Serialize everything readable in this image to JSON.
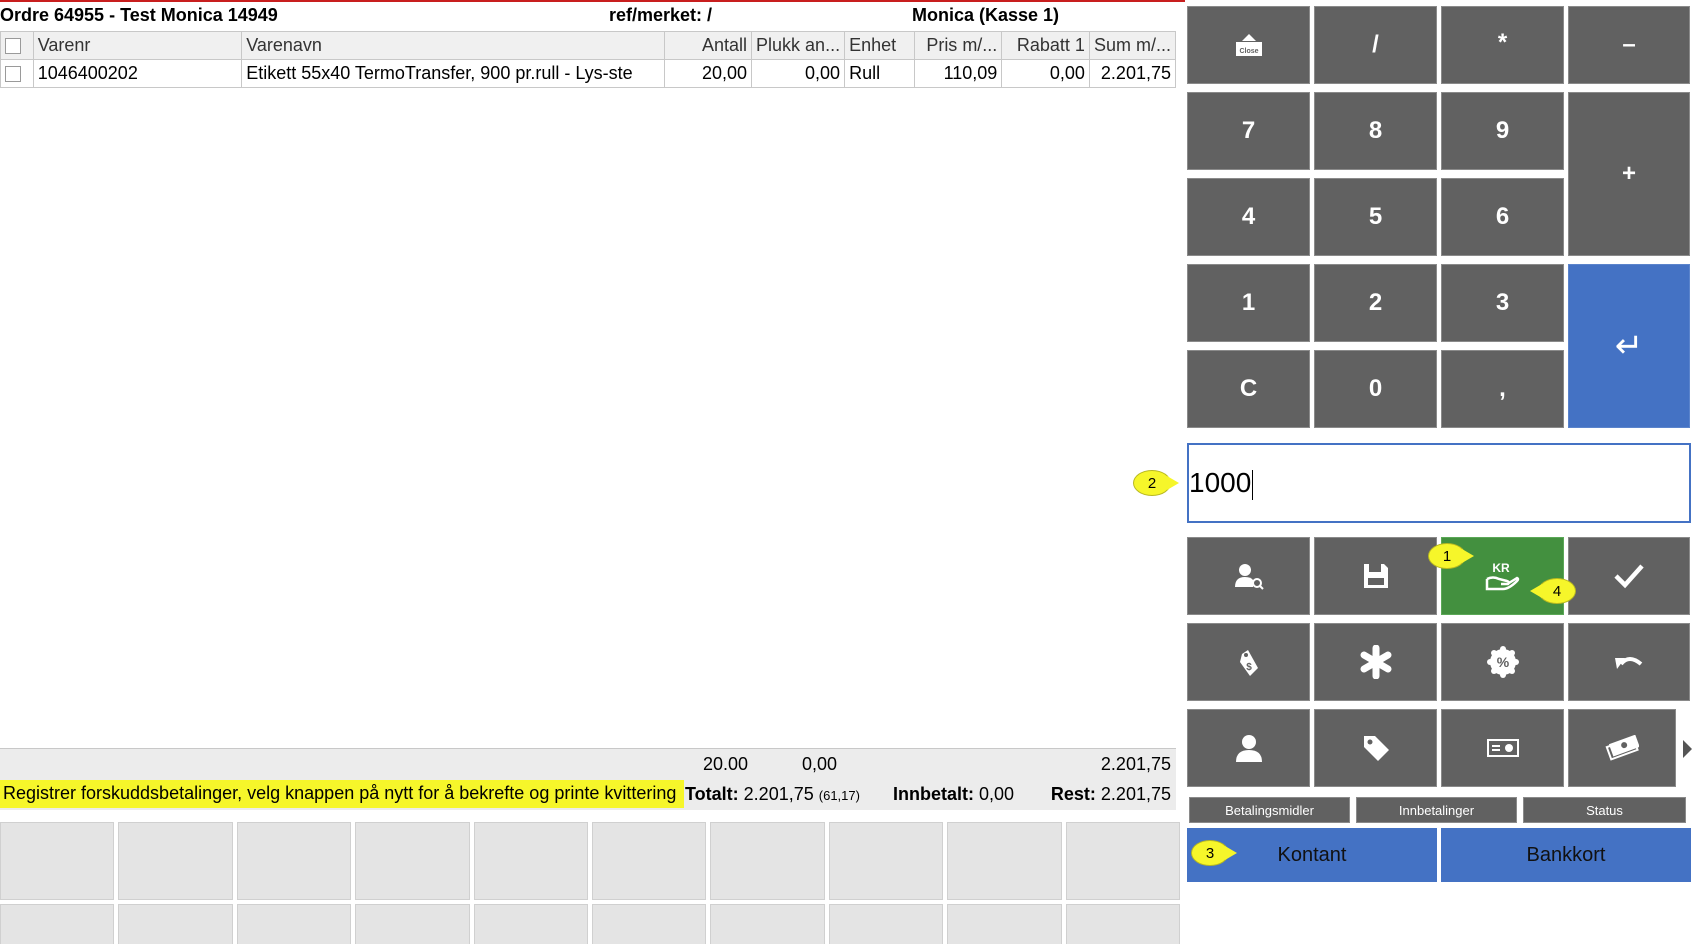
{
  "header": {
    "order_title": "Ordre 64955 - Test Monica 14949",
    "reference": "ref/merket: /",
    "user_register": "Monica (Kasse 1)"
  },
  "table": {
    "columns": [
      "Varenr",
      "Varenavn",
      "Antall",
      "Plukk an...",
      "Enhet",
      "Pris m/...",
      "Rabatt 1",
      "Sum m/..."
    ],
    "rows": [
      {
        "varenr": "1046400202",
        "varenavn": "Etikett 55x40 TermoTransfer, 900 pr.rull - Lys-ste",
        "antall": "20,00",
        "plukk": "0,00",
        "enhet": "Rull",
        "pris": "110,09",
        "rabatt": "0,00",
        "sum": "2.201,75"
      }
    ]
  },
  "totals": {
    "antall": "20.00",
    "plukk": "0,00",
    "sum": "2.201,75"
  },
  "info": {
    "message": "Registrer forskuddsbetalinger, velg knappen på nytt for å bekrefte og printe kvittering",
    "totalt_label": "Totalt:",
    "totalt_value": "2.201,75",
    "totalt_sub": "(61,17)",
    "innbetalt_label": "Innbetalt:",
    "innbetalt_value": "0,00",
    "rest_label": "Rest:",
    "rest_value": "2.201,75"
  },
  "keypad": {
    "close_label": "Close",
    "slash": "/",
    "star": "*",
    "minus": "–",
    "k7": "7",
    "k8": "8",
    "k9": "9",
    "plus": "+",
    "k4": "4",
    "k5": "5",
    "k6": "6",
    "k1": "1",
    "k2": "2",
    "k3": "3",
    "clear": "C",
    "k0": "0",
    "comma": ",",
    "enter_symbol": "↵",
    "kr_label": "KR"
  },
  "input": {
    "value": "1000"
  },
  "tabs": [
    "Betalingsmidler",
    "Innbetalinger",
    "Status"
  ],
  "payment": {
    "cash": "Kontant",
    "card": "Bankkort"
  },
  "callouts": {
    "c1": "1",
    "c2": "2",
    "c3": "3",
    "c4": "4"
  },
  "colors": {
    "key_gray": "#616161",
    "accent_blue": "#4472c4",
    "active_green": "#43903f",
    "highlight_yellow": "#f6f62a"
  }
}
